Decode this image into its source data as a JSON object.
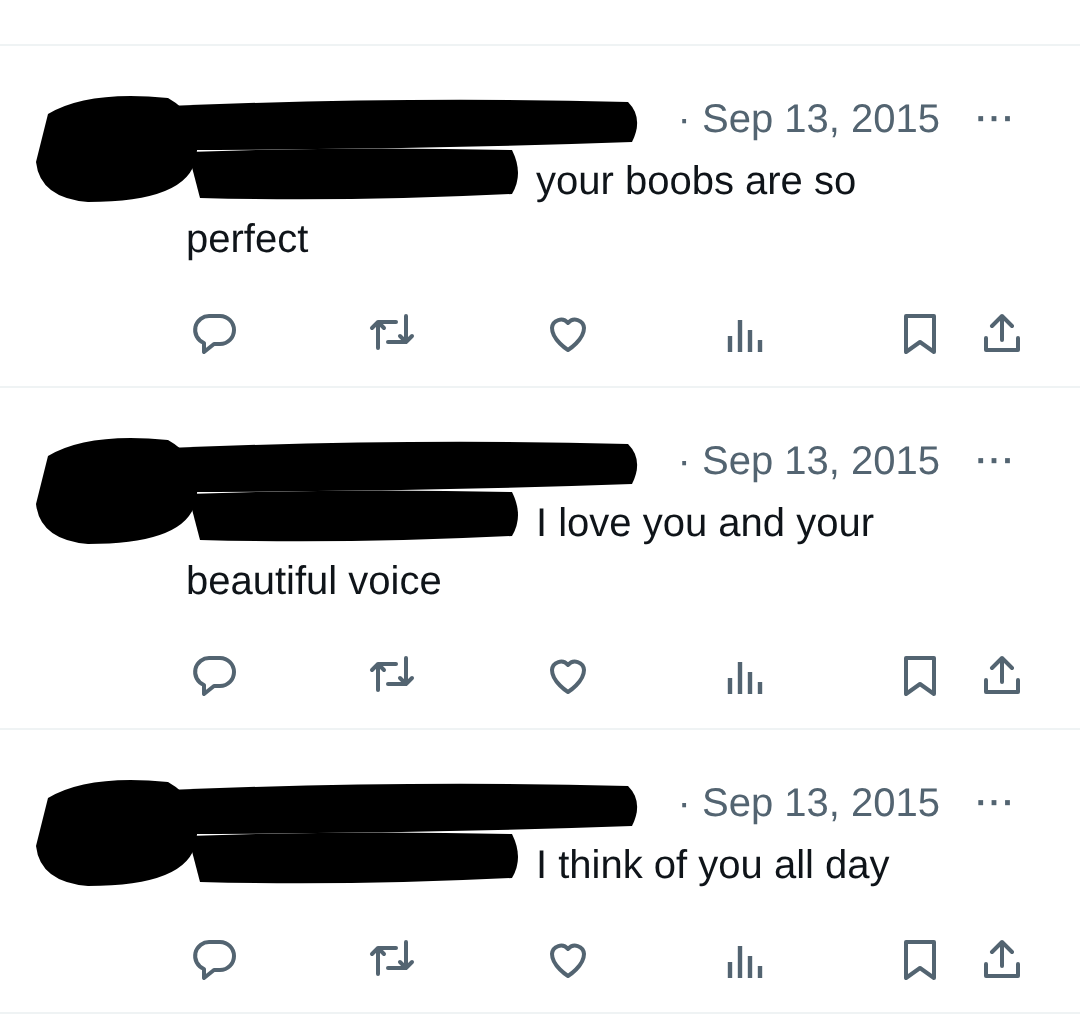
{
  "tweets": [
    {
      "redacted": true,
      "date": "· Sep 13, 2015",
      "more": "···",
      "text": "your boobs are so perfect"
    },
    {
      "redacted": true,
      "date": "· Sep 13, 2015",
      "more": "···",
      "text": "I love you and your beautiful voice"
    },
    {
      "redacted": true,
      "date": "· Sep 13, 2015",
      "more": "···",
      "text": "I think of you all day"
    }
  ]
}
